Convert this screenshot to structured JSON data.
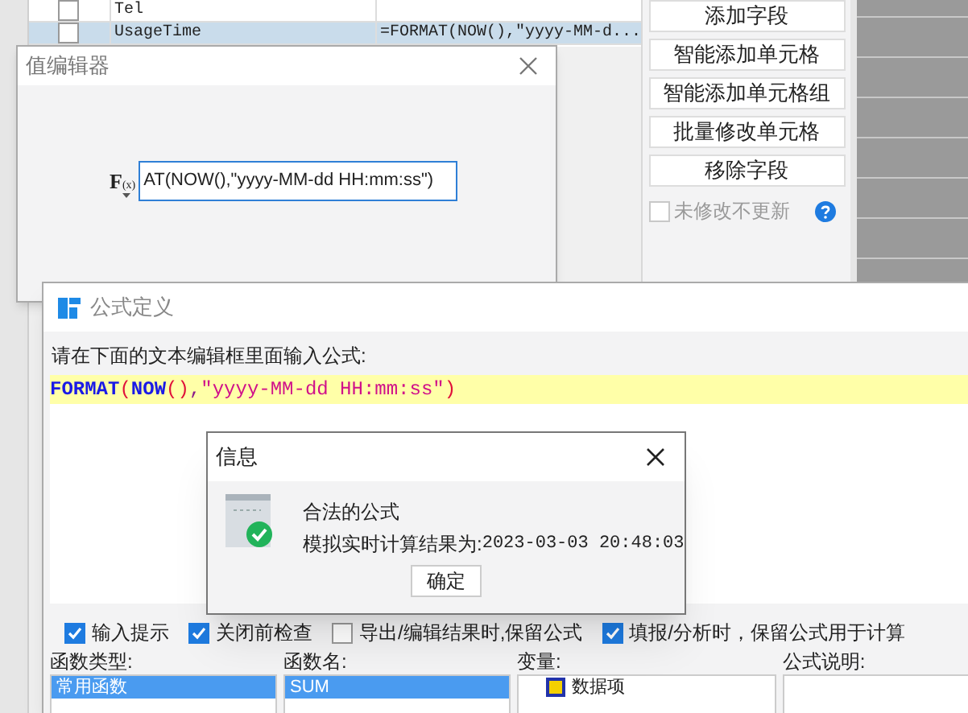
{
  "table": {
    "rows": [
      {
        "checked": false,
        "name": "Tel",
        "selected": false
      },
      {
        "checked": false,
        "name": "UsageTime",
        "value": "=FORMAT(NOW(),\"yyyy-MM-d...",
        "selected": true
      }
    ]
  },
  "side_buttons": [
    "添加字段",
    "智能添加单元格",
    "智能添加单元格组",
    "批量修改单元格",
    "移除字段"
  ],
  "no_update_checkbox": {
    "label": "未修改不更新",
    "checked": false,
    "disabled": true
  },
  "value_editor": {
    "title": "值编辑器",
    "function_button": {
      "main": "F",
      "sub": "(x)"
    },
    "formula_value": "AT(NOW(),\"yyyy-MM-dd HH:mm:ss\")"
  },
  "formula_dialog": {
    "title": "公式定义",
    "prompt": "请在下面的文本编辑框里面输入公式:",
    "formula_tokens": [
      {
        "kind": "function",
        "text": "FORMAT"
      },
      {
        "kind": "paren",
        "text": "("
      },
      {
        "kind": "function",
        "text": "NOW"
      },
      {
        "kind": "paren",
        "text": "()"
      },
      {
        "kind": "plain",
        "text": ","
      },
      {
        "kind": "string",
        "text": "\"yyyy-MM-dd HH:mm:ss\""
      },
      {
        "kind": "paren",
        "text": ")"
      }
    ],
    "options": [
      {
        "label": "输入提示",
        "checked": true
      },
      {
        "label": "关闭前检查",
        "checked": true
      },
      {
        "label": "导出/编辑结果时,保留公式",
        "checked": false
      },
      {
        "label": "填报/分析时，保留公式用于计算",
        "checked": true
      }
    ],
    "panels": [
      {
        "label": "函数类型:",
        "item": "常用函数",
        "selected": true
      },
      {
        "label": "函数名:",
        "item": "SUM",
        "selected": true
      },
      {
        "label": "变量:",
        "item": "数据项",
        "selected": false
      },
      {
        "label": "公式说明:"
      }
    ]
  },
  "info_dialog": {
    "title": "信息",
    "message": "合法的公式",
    "result_label": "模拟实时计算结果为:",
    "result_value": "2023-03-03 20:48:03",
    "ok_button": "确定"
  }
}
